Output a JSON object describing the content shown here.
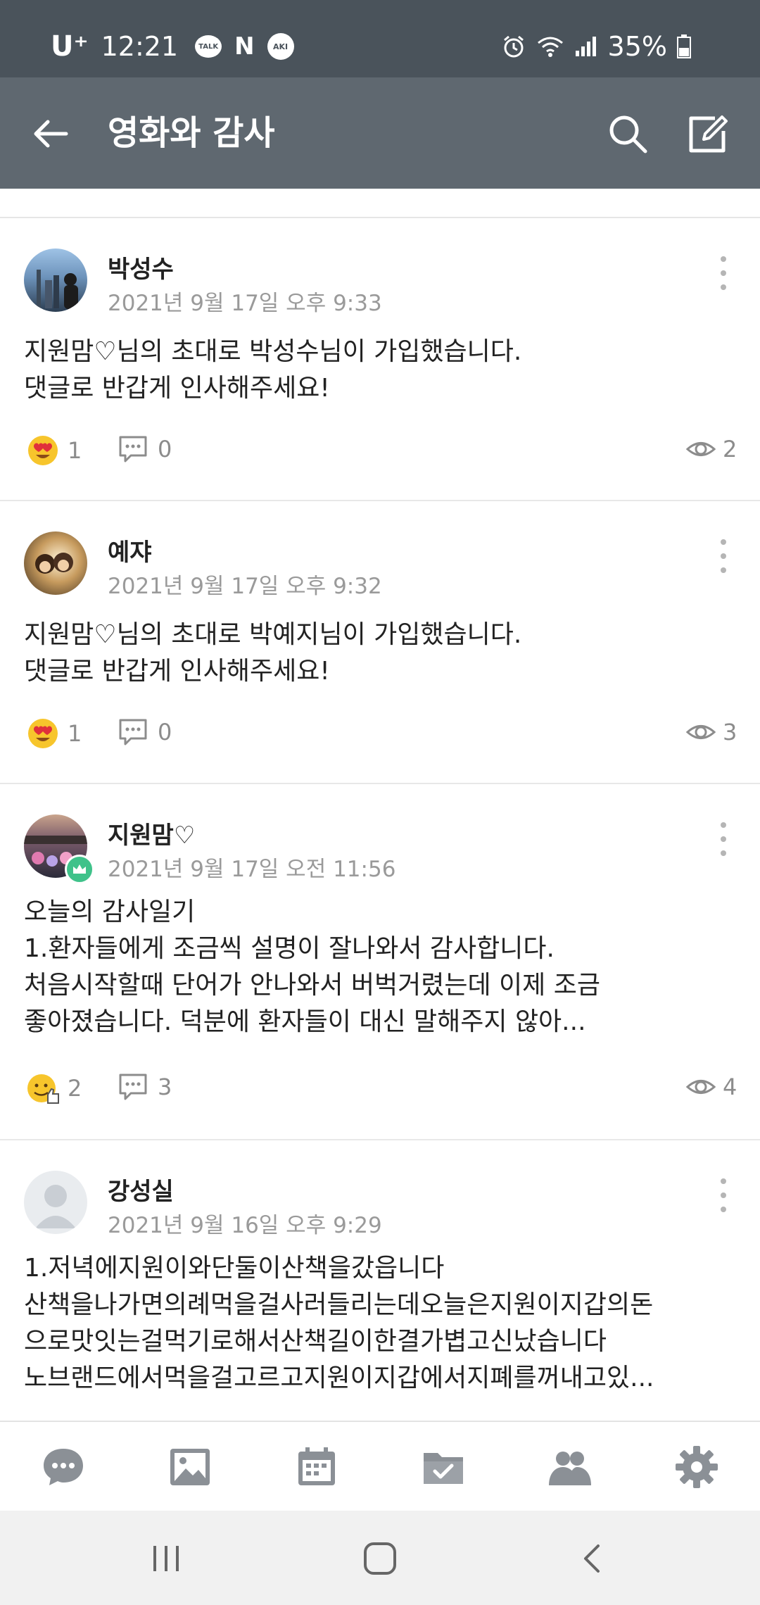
{
  "status_bar": {
    "carrier": "U⁺",
    "time": "12:21",
    "notif_talk": "TALK",
    "notif_n": "N",
    "notif_aki": "AKI",
    "battery": "35%",
    "icons": [
      "talk-icon",
      "naver-icon",
      "aki-icon",
      "alarm-icon",
      "wifi-icon",
      "signal-icon",
      "battery-icon"
    ]
  },
  "app_bar": {
    "title": "영화와 감사",
    "icons": [
      "back-arrow-icon",
      "search-icon",
      "compose-icon"
    ]
  },
  "posts": [
    {
      "author": "박성수",
      "date": "2021년 9월 17일 오후 9:33",
      "body": "지원맘♡님의 초대로 박성수님이 가입했습니다.\n댓글로 반갑게 인사해주세요!",
      "reaction_icon": "heart-eyes-emoji-icon",
      "reactions": "1",
      "comments": "0",
      "views": "2"
    },
    {
      "author": "예쟈",
      "date": "2021년 9월 17일 오후 9:32",
      "body": "지원맘♡님의 초대로 박예지님이 가입했습니다.\n댓글로 반갑게 인사해주세요!",
      "reaction_icon": "heart-eyes-emoji-icon",
      "reactions": "1",
      "comments": "0",
      "views": "3"
    },
    {
      "author": "지원맘♡",
      "date": "2021년 9월 17일 오전 11:56",
      "body": "오늘의 감사일기\n1.환자들에게 조금씩 설명이 잘나와서 감사합니다.\n처음시작할때 단어가 안나와서 버벅거렸는데 이제 조금\n좋아졌습니다. 덕분에 환자들이 대신 말해주지 않아...",
      "reaction_icon": "thumbs-up-emoji-icon",
      "reactions": "2",
      "comments": "3",
      "views": "4",
      "admin": true
    },
    {
      "author": "강성실",
      "date": "2021년 9월 16일 오후 9:29",
      "body": "1.저녁에지원이와단둘이산책을갔읍니다\n산책을나가면의례먹을걸사러들리는데오늘은지원이지갑의돈\n으로맛잇는걸먹기로해서산책길이한결가볍고신났습니다\n노브랜드에서먹을걸고르고지원이지갑에서지폐를꺼내고있..."
    }
  ],
  "bottom_nav": {
    "items": [
      "chat-icon",
      "photo-icon",
      "calendar-icon",
      "folder-icon",
      "members-icon",
      "settings-icon"
    ]
  },
  "system_nav": {
    "items": [
      "recent-apps-icon",
      "home-icon",
      "back-icon"
    ]
  },
  "colors": {
    "status_bar": "#4a535b",
    "app_bar": "#5f6870",
    "admin_badge": "#3fc28a",
    "muted_text": "#9a9a9a"
  }
}
